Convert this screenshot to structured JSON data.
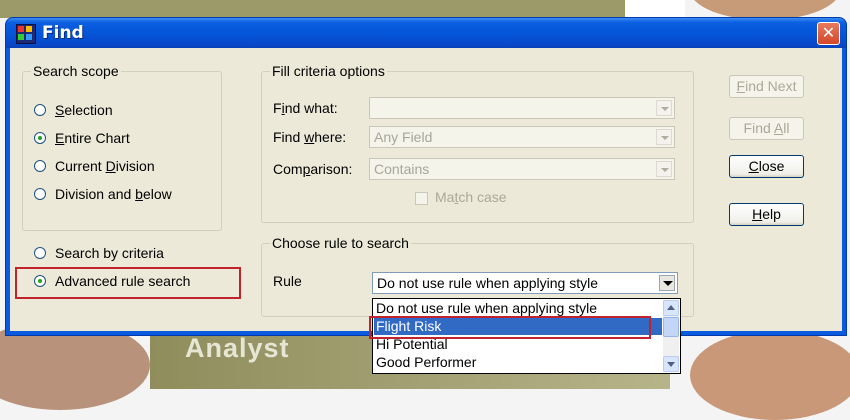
{
  "window": {
    "title": "Find",
    "close_symbol": "✕"
  },
  "background": {
    "partial_text": "Analyst"
  },
  "search_scope": {
    "group_label": "Search scope",
    "options": [
      {
        "label": "Selection",
        "mnemonic": "S",
        "checked": false
      },
      {
        "label": "Entire Chart",
        "mnemonic": "E",
        "checked": true
      },
      {
        "label": "Current Division",
        "mnemonic": "D",
        "checked": false
      },
      {
        "label": "Division and below",
        "mnemonic": "b",
        "checked": false
      }
    ]
  },
  "search_mode": {
    "by_criteria": {
      "label": "Search by criteria",
      "checked": false
    },
    "advanced_rule": {
      "label": "Advanced rule search",
      "checked": true
    }
  },
  "fill_criteria": {
    "group_label": "Fill criteria options",
    "find_what": {
      "label": "Find what:",
      "value": ""
    },
    "find_where": {
      "label": "Find where:",
      "value": "Any Field"
    },
    "comparison": {
      "label": "Comparison:",
      "value": "Contains"
    },
    "match_case": {
      "label": "Match case",
      "checked": false
    }
  },
  "rule_group": {
    "group_label": "Choose rule to search",
    "rule_label": "Rule",
    "rule_value": "Do not use rule when applying style"
  },
  "buttons": {
    "find_next": "Find Next",
    "find_all": "Find All",
    "close": "Close",
    "help": "Help"
  },
  "rule_dropdown": {
    "options": [
      "Do not use rule when applying style",
      "Flight Risk",
      "Hi Potential",
      "Good Performer"
    ],
    "selected_index": 1
  },
  "colors": {
    "title_bar": "#0554d8",
    "highlight_outline": "#c0232c",
    "selection": "#316ac5"
  }
}
